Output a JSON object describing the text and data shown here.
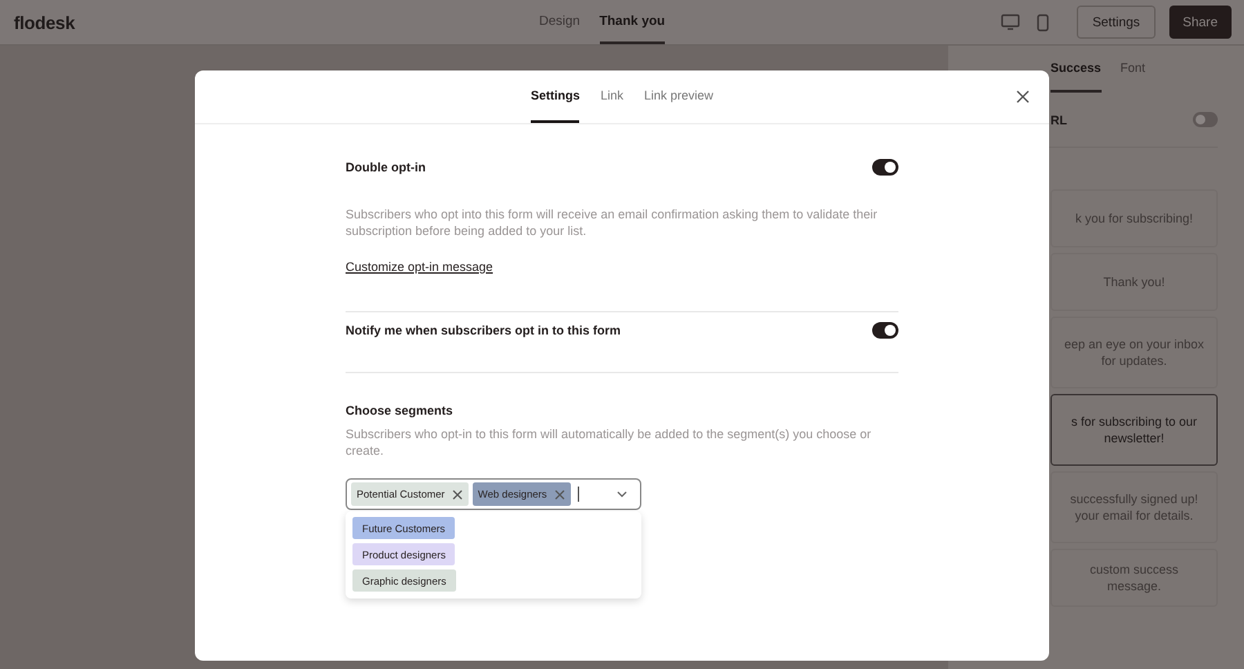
{
  "app": {
    "logo": "flodesk"
  },
  "editor_tabs": [
    {
      "label": "Design",
      "selected": false
    },
    {
      "label": "Thank you",
      "selected": true
    }
  ],
  "toolbar": {
    "settings_button": "Settings",
    "share_button": "Share"
  },
  "side_panel": {
    "tabs": [
      {
        "label": "Success",
        "selected": true
      },
      {
        "label": "Font",
        "selected": false
      }
    ],
    "url_setting": {
      "label": "RL",
      "on": false
    },
    "messages": [
      {
        "text": "k you for subscribing!",
        "selected": false
      },
      {
        "text": "Thank you!",
        "selected": false
      },
      {
        "text": "eep an eye on your inbox for updates.",
        "selected": false
      },
      {
        "text": "s for subscribing to our newsletter!",
        "selected": true
      },
      {
        "text": "successfully signed up! your email for details.",
        "selected": false
      },
      {
        "text": "custom success message.",
        "selected": false
      }
    ]
  },
  "modal": {
    "tabs": [
      {
        "label": "Settings",
        "selected": true
      },
      {
        "label": "Link",
        "selected": false
      },
      {
        "label": "Link preview",
        "selected": false
      }
    ],
    "sections": [
      {
        "kind": "toggle",
        "title": "Double opt-in",
        "on": true,
        "description": "Subscribers who opt into this form will receive an email confirmation asking them to validate their subscription before being added to your list.",
        "link": "Customize opt-in message"
      },
      {
        "kind": "toggle",
        "title": "Notify me when subscribers opt in to this form",
        "on": true
      },
      {
        "kind": "segments",
        "title": "Choose segments",
        "description": "Subscribers who opt-in to this form will automatically be added to the segment(s) you choose or create.",
        "selected_tags": [
          {
            "label": "Potential Customer",
            "color": "#dde4df"
          },
          {
            "label": "Web designers",
            "color": "#8b9bb6"
          }
        ],
        "options": [
          {
            "label": "Future Customers",
            "color": "#a9bde9"
          },
          {
            "label": "Product designers",
            "color": "#ddd7f6"
          },
          {
            "label": "Graphic designers",
            "color": "#d9e1db"
          }
        ]
      }
    ]
  }
}
